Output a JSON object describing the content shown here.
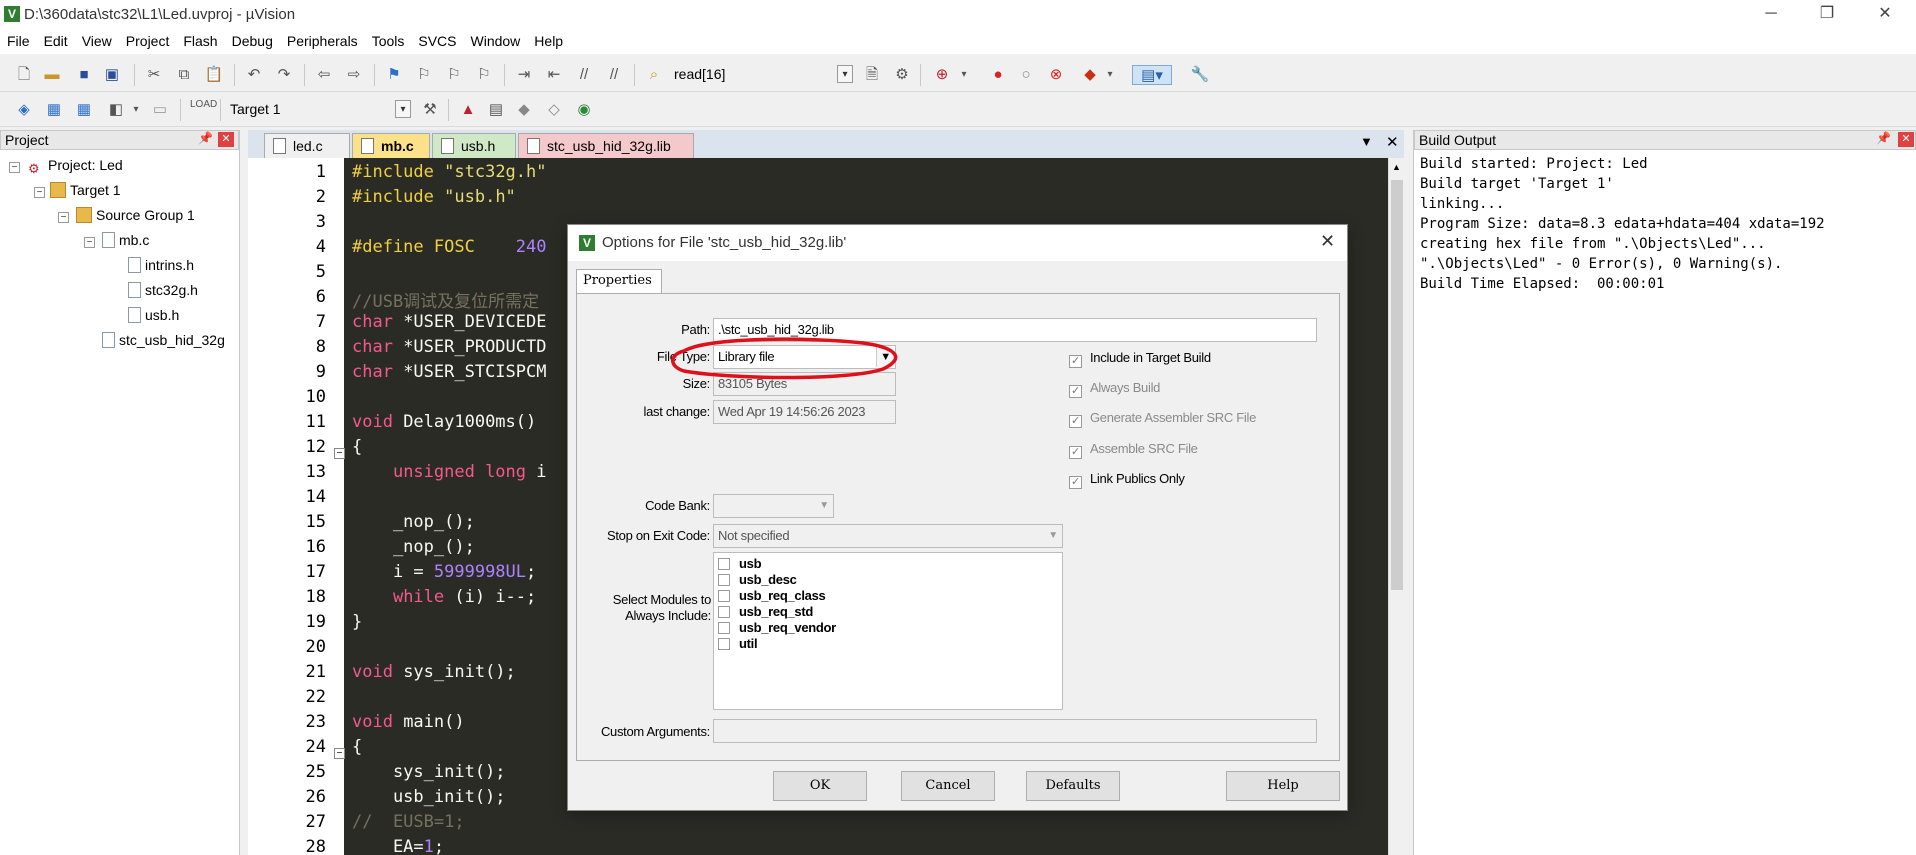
{
  "window": {
    "title": "D:\\360data\\stc32\\L1\\Led.uvproj - µVision",
    "app_icon": "uv-icon",
    "controls": [
      "─",
      "❐",
      "✕"
    ]
  },
  "menu": [
    "File",
    "Edit",
    "View",
    "Project",
    "Flash",
    "Debug",
    "Peripherals",
    "Tools",
    "SVCS",
    "Window",
    "Help"
  ],
  "toolbar1": {
    "find_combo": "read[16]"
  },
  "toolbar2": {
    "target_combo": "Target 1"
  },
  "project_panel": {
    "title": "Project",
    "tree": [
      "Project: Led",
      "Target 1",
      "Source Group 1",
      "mb.c",
      "intrins.h",
      "stc32g.h",
      "usb.h",
      "stc_usb_hid_32g"
    ]
  },
  "editor": {
    "tabs": [
      "led.c",
      "mb.c",
      "usb.h",
      "stc_usb_hid_32g.lib"
    ],
    "line_numbers": [
      "1",
      "2",
      "3",
      "4",
      "5",
      "6",
      "7",
      "8",
      "9",
      "10",
      "11",
      "12",
      "13",
      "14",
      "15",
      "16",
      "17",
      "18",
      "19",
      "20",
      "21",
      "22",
      "23",
      "24",
      "25",
      "26",
      "27",
      "28"
    ]
  },
  "build_output": {
    "title": "Build Output",
    "lines": [
      "Build started: Project: Led",
      "Build target 'Target 1'",
      "linking...",
      "Program Size: data=8.3 edata+hdata=404 xdata=192",
      "creating hex file from \".\\Objects\\Led\"...",
      "\".\\Objects\\Led\" - 0 Error(s), 0 Warning(s).",
      "Build Time Elapsed:  00:00:01"
    ]
  },
  "dialog": {
    "title": "Options for File 'stc_usb_hid_32g.lib'",
    "tab": "Properties",
    "path_label": "Path:",
    "path_value": ".\\stc_usb_hid_32g.lib",
    "filetype_label": "File Type:",
    "filetype_value": "Library file",
    "size_label": "Size:",
    "size_value": "83105 Bytes",
    "lastchange_label": "last change:",
    "lastchange_value": "Wed Apr 19 14:56:26 2023",
    "codebank_label": "Code Bank:",
    "stop_label": "Stop on Exit Code:",
    "stop_value": "Not specified",
    "modules_label": "Select Modules to Always Include:",
    "modules": [
      "usb",
      "usb_desc",
      "usb_req_class",
      "usb_req_std",
      "usb_req_vendor",
      "util"
    ],
    "custom_label": "Custom Arguments:",
    "checks": [
      {
        "label": "Include in Target Build",
        "checked": true,
        "enabled": true
      },
      {
        "label": "Always Build",
        "checked": true,
        "enabled": false
      },
      {
        "label": "Generate Assembler SRC File",
        "checked": true,
        "enabled": false
      },
      {
        "label": "Assemble SRC File",
        "checked": true,
        "enabled": false
      },
      {
        "label": "Link Publics Only",
        "checked": true,
        "enabled": true
      }
    ],
    "buttons": {
      "ok": "OK",
      "cancel": "Cancel",
      "defaults": "Defaults",
      "help": "Help"
    },
    "annotation_color": "#e0101a"
  }
}
